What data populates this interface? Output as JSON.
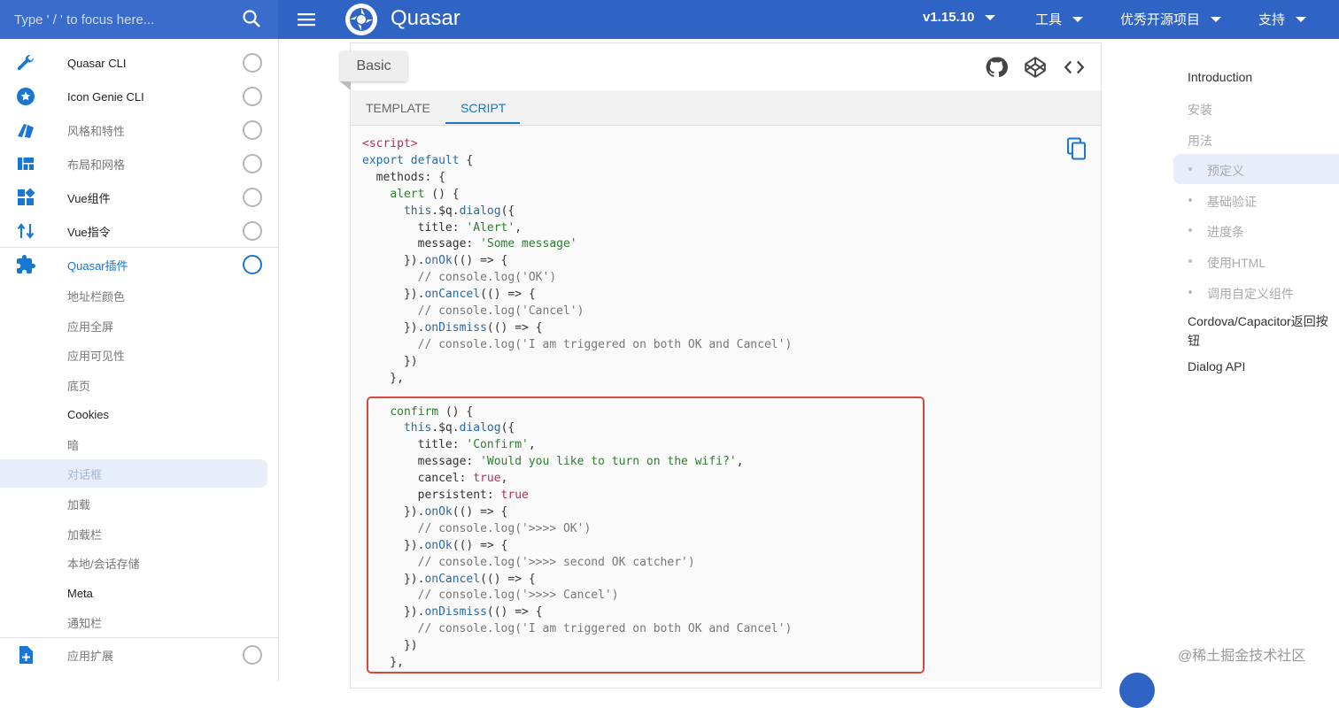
{
  "header": {
    "search_placeholder": "Type ' / ' to focus here...",
    "brand": "Quasar",
    "version": "v1.15.10",
    "nav": [
      "工具",
      "优秀开源项目",
      "支持"
    ]
  },
  "sidebar": {
    "items": [
      {
        "label": "Quasar CLI",
        "icon": "wrench-icon"
      },
      {
        "label": "Icon Genie CLI",
        "icon": "star-badge-icon"
      },
      {
        "label": "风格和特性",
        "icon": "palette-icon"
      },
      {
        "label": "布局和网格",
        "icon": "layout-icon"
      },
      {
        "label": "Vue组件",
        "icon": "widgets-icon"
      },
      {
        "label": "Vue指令",
        "icon": "swap-icon"
      },
      {
        "label": "Quasar插件",
        "icon": "puzzle-icon"
      }
    ],
    "subitems": [
      "地址栏颜色",
      "应用全屏",
      "应用可见性",
      "底页",
      "Cookies",
      "暗",
      "对话框",
      "加载",
      "加载栏",
      "本地/会话存储",
      "Meta",
      "通知栏"
    ],
    "bottom_item": {
      "label": "应用扩展",
      "icon": "add-box-icon"
    }
  },
  "demo": {
    "title": "Basic",
    "tabs": [
      "TEMPLATE",
      "SCRIPT"
    ],
    "active_tab": "SCRIPT"
  },
  "toc": {
    "items": [
      "Introduction",
      "安装",
      "用法",
      "预定义",
      "基础验证",
      "进度条",
      "使用HTML",
      "调用自定义组件",
      "Cordova/Capacitor返回按钮",
      "Dialog API"
    ]
  },
  "watermark": "@稀土掘金技术社区",
  "colors": {
    "header": "#2f63c4",
    "accent": "#1976d2",
    "highlight": "#d94a3d"
  }
}
